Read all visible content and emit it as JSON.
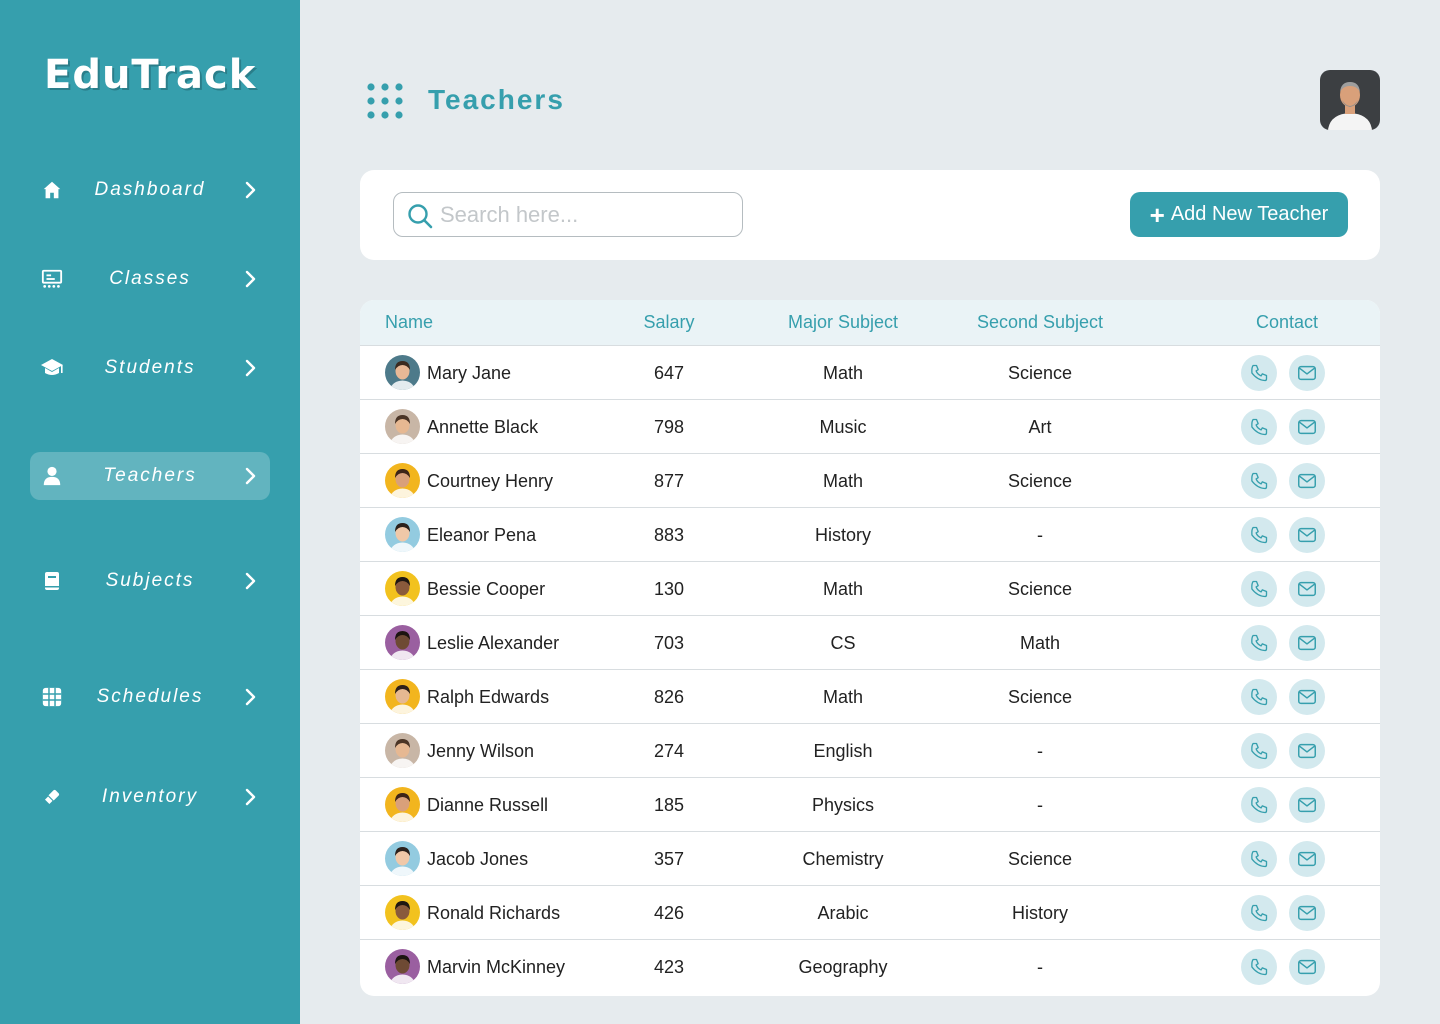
{
  "app": {
    "name": "EduTrack"
  },
  "sidebar": {
    "items": [
      {
        "label": "Dashboard",
        "icon": "home-icon",
        "active": false
      },
      {
        "label": "Classes",
        "icon": "classes-icon",
        "active": false
      },
      {
        "label": "Students",
        "icon": "graduation-cap-icon",
        "active": false
      },
      {
        "label": "Teachers",
        "icon": "person-icon",
        "active": true
      },
      {
        "label": "Subjects",
        "icon": "book-icon",
        "active": false
      },
      {
        "label": "Schedules",
        "icon": "calendar-grid-icon",
        "active": false
      },
      {
        "label": "Inventory",
        "icon": "eraser-icon",
        "active": false
      }
    ]
  },
  "header": {
    "title": "Teachers"
  },
  "toolbar": {
    "search_placeholder": "Search here...",
    "add_label": "Add New Teacher"
  },
  "table": {
    "columns": [
      "Name",
      "Salary",
      "Major Subject",
      "Second Subject",
      "Contact"
    ],
    "rows": [
      {
        "name": "Mary  Jane",
        "salary": "647",
        "major": "Math",
        "second": "Science",
        "avatar_bg": "#4d7a8a",
        "skin": "#e8b896",
        "hair": "#3a2a20"
      },
      {
        "name": "Annette Black",
        "salary": "798",
        "major": "Music",
        "second": "Art",
        "avatar_bg": "#c8b6a6",
        "skin": "#e6b892",
        "hair": "#4b3526"
      },
      {
        "name": "Courtney Henry",
        "salary": "877",
        "major": "Math",
        "second": "Science",
        "avatar_bg": "#f2b51e",
        "skin": "#d9a07a",
        "hair": "#3d2418"
      },
      {
        "name": "Eleanor Pena",
        "salary": "883",
        "major": "History",
        "second": "-",
        "avatar_bg": "#93cbe0",
        "skin": "#f0c8a8",
        "hair": "#2b211c"
      },
      {
        "name": "Bessie Cooper",
        "salary": "130",
        "major": "Math",
        "second": "Science",
        "avatar_bg": "#f2c21e",
        "skin": "#8a5a3c",
        "hair": "#1f1712"
      },
      {
        "name": "Leslie Alexander",
        "salary": "703",
        "major": "CS",
        "second": "Math",
        "avatar_bg": "#9a5fa0",
        "skin": "#6e4a34",
        "hair": "#1c1410"
      },
      {
        "name": "Ralph Edwards",
        "salary": "826",
        "major": "Math",
        "second": "Science",
        "avatar_bg": "#f2b51e",
        "skin": "#e6b892",
        "hair": "#2e2119"
      },
      {
        "name": "Jenny Wilson",
        "salary": "274",
        "major": "English",
        "second": "-",
        "avatar_bg": "#c8b6a6",
        "skin": "#e6b892",
        "hair": "#4b3526"
      },
      {
        "name": "Dianne Russell",
        "salary": "185",
        "major": "Physics",
        "second": "-",
        "avatar_bg": "#f2b51e",
        "skin": "#d9a07a",
        "hair": "#3d2418"
      },
      {
        "name": "Jacob Jones",
        "salary": "357",
        "major": "Chemistry",
        "second": "Science",
        "avatar_bg": "#93cbe0",
        "skin": "#f0c8a8",
        "hair": "#2b211c"
      },
      {
        "name": "Ronald Richards",
        "salary": "426",
        "major": "Arabic",
        "second": "History",
        "avatar_bg": "#f2c21e",
        "skin": "#8a5a3c",
        "hair": "#1f1712"
      },
      {
        "name": "Marvin McKinney",
        "salary": "423",
        "major": "Geography",
        "second": "-",
        "avatar_bg": "#9a5fa0",
        "skin": "#6e4a34",
        "hair": "#1c1410"
      }
    ]
  },
  "colors": {
    "accent": "#369fad",
    "background": "#e6ebee",
    "table_header": "#eaf3f6",
    "contact_button": "#d3e9ee"
  }
}
